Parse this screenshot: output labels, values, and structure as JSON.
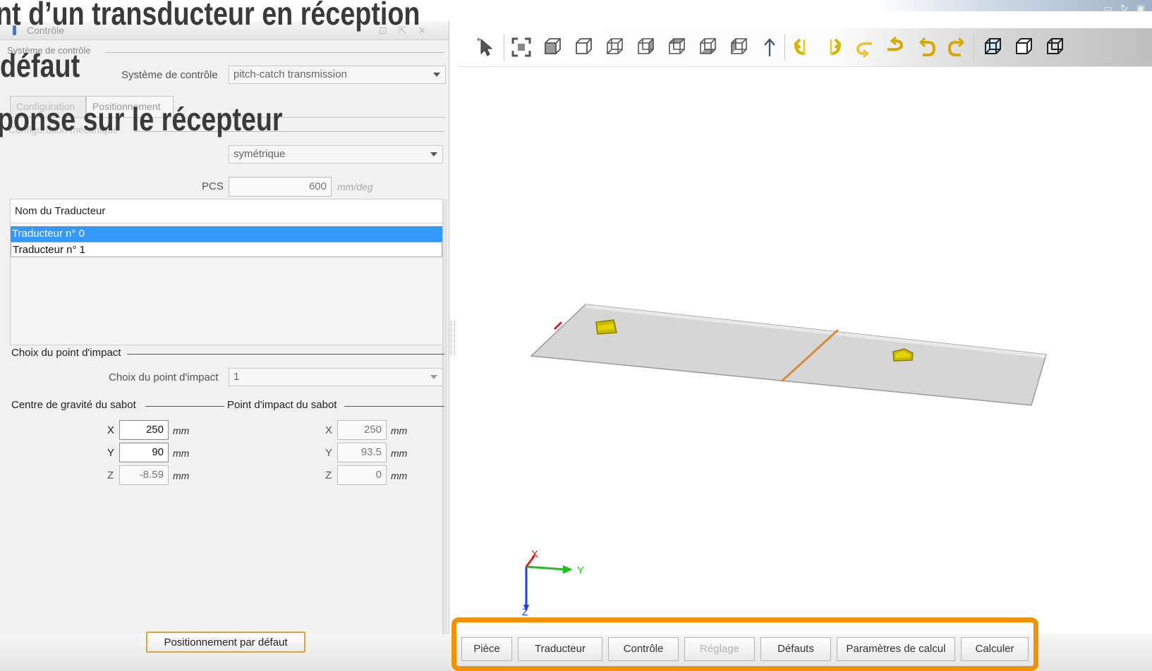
{
  "slide": {
    "title_line1": "nt d’un transducteur en réception",
    "title_line2": "défaut",
    "title_line3": "ponse sur le récepteur"
  },
  "left_panel": {
    "window_title": "Contrôle",
    "header_buttons": "⊡ ⇱ ✕",
    "group_system_label": "Système de contrôle",
    "system_field_label": "Système de contrôle",
    "system_value": "pitch-catch transmission",
    "tabs": [
      {
        "label": "Configuration",
        "active": false
      },
      {
        "label": "Positionnement",
        "active": true
      }
    ],
    "mech_group_label": "Configuration mécanique",
    "mech_value": "symétrique",
    "pcs_label": "PCS",
    "pcs_value": "600",
    "pcs_unit": "mm/deg",
    "list_header": "Nom du Traducteur",
    "transducers": [
      "Traducteur n° 0",
      "Traducteur n° 1"
    ],
    "impact_group_label": "Choix du point d'impact",
    "impact_field_label": "Choix du point d'impact",
    "impact_value": "1",
    "cog_group_label": "Centre de gravité du sabot",
    "impact_point_group_label": "Point d'impact du sabot",
    "cog": {
      "x": {
        "label": "X",
        "value": "250",
        "unit": "mm"
      },
      "y": {
        "label": "Y",
        "value": "90",
        "unit": "mm"
      },
      "z": {
        "label": "Z",
        "value": "-8.59",
        "unit": "mm"
      }
    },
    "impact_point": {
      "x": {
        "label": "X",
        "value": "250",
        "unit": "mm"
      },
      "y": {
        "label": "Y",
        "value": "93.5",
        "unit": "mm"
      },
      "z": {
        "label": "Z",
        "value": "0",
        "unit": "mm"
      }
    },
    "default_button": "Positionnement par défaut"
  },
  "toolbar": {
    "icons": [
      "select-pointer-icon",
      "fit-view-icon",
      "view-front-icon",
      "view-back-icon",
      "view-left-icon",
      "view-right-icon",
      "view-top-icon",
      "view-bottom-icon",
      "view-iso-icon",
      "axis-up-icon",
      "rotate-x-neg-icon",
      "rotate-x-pos-icon",
      "rotate-y-neg-icon",
      "rotate-y-pos-icon",
      "rotate-z-neg-icon",
      "rotate-z-pos-icon",
      "render-shaded-icon",
      "render-wireframe-icon",
      "render-hidden-line-icon"
    ]
  },
  "scene": {
    "axis_labels": {
      "x": "X",
      "y": "Y",
      "z": "Z"
    },
    "colors": {
      "plate": "#d4d4d4",
      "weld_line": "#d98a3a",
      "probe": "#c9b800",
      "axis_x": "#e02020",
      "axis_y": "#20c020",
      "axis_z": "#2040e0"
    }
  },
  "bottom_tabs": [
    {
      "label": "Pièce",
      "enabled": true
    },
    {
      "label": "Traducteur",
      "enabled": true
    },
    {
      "label": "Contrôle",
      "enabled": true
    },
    {
      "label": "Réglage",
      "enabled": false
    },
    {
      "label": "Défauts",
      "enabled": true
    },
    {
      "label": "Paramètres de calcul",
      "enabled": true
    },
    {
      "label": "Calculer",
      "enabled": true
    }
  ],
  "colors": {
    "highlight": "#f39200",
    "selection": "#3399ff"
  }
}
